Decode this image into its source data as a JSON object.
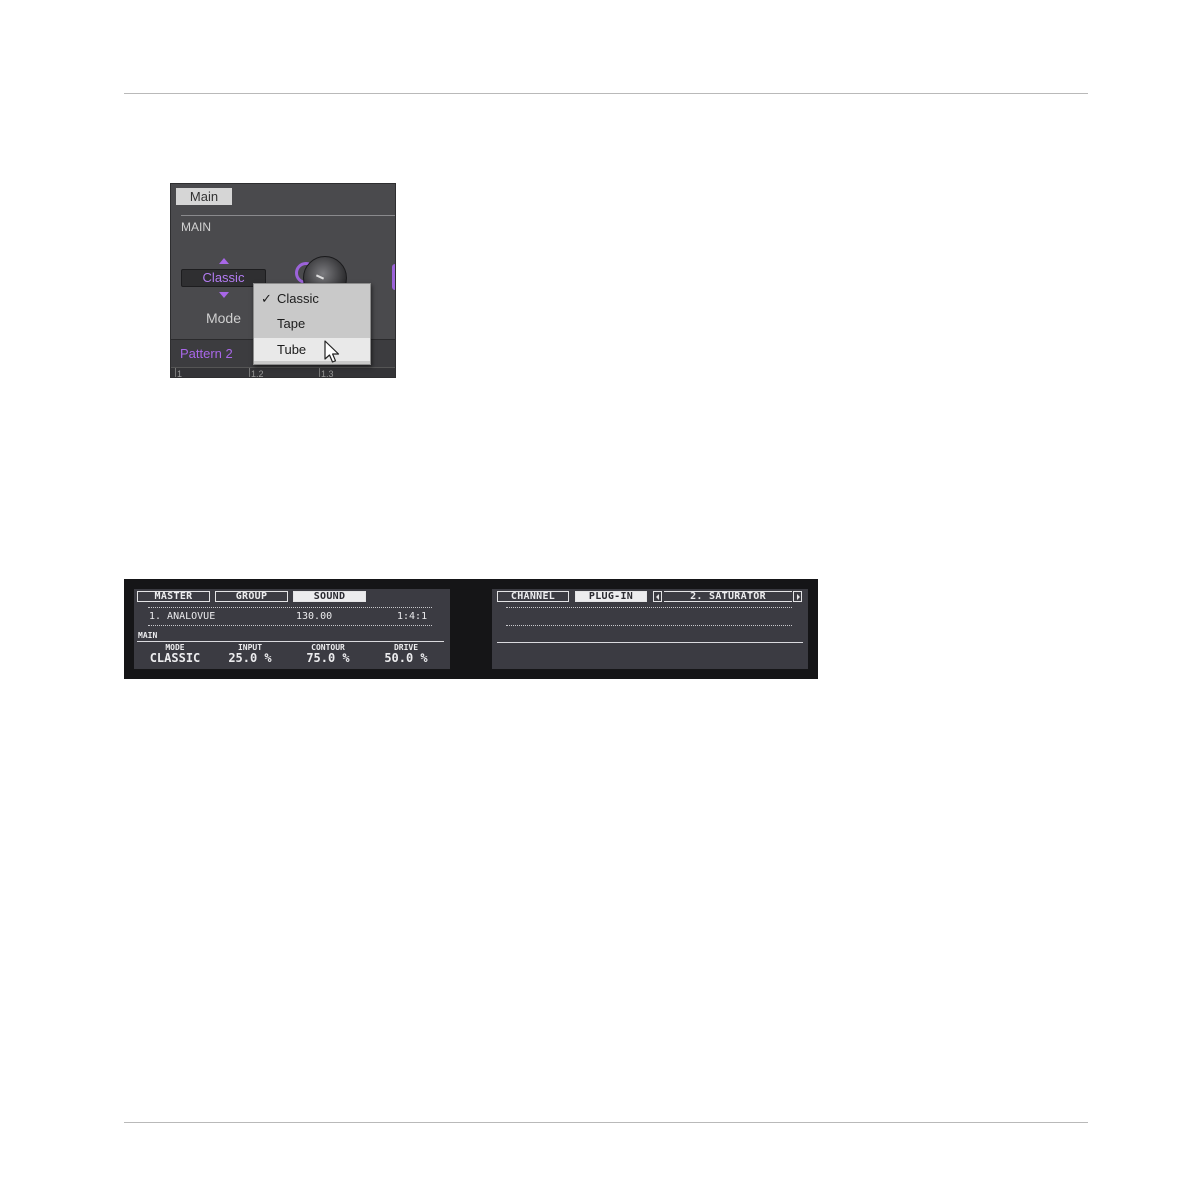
{
  "software": {
    "tab": "Main",
    "section": "MAIN",
    "mode_value": "Classic",
    "mode_label": "Mode",
    "pattern": "Pattern 2",
    "ruler": [
      "1",
      "1.2",
      "1.3"
    ],
    "menu": [
      {
        "label": "Classic",
        "checked": true
      },
      {
        "label": "Tape",
        "checked": false
      },
      {
        "label": "Tube",
        "checked": false,
        "hovered": true
      }
    ],
    "colors": {
      "accent": "#a867e8",
      "panel": "#4a4a4d"
    }
  },
  "hardware": {
    "left": {
      "tabs": [
        "MASTER",
        "GROUP",
        "SOUND"
      ],
      "selected_tab": "SOUND",
      "info": {
        "name": "1. ANALOVUE",
        "tempo": "130.00",
        "position": "1:4:1"
      },
      "section": "MAIN",
      "params": [
        {
          "name": "MODE",
          "value": "CLASSIC"
        },
        {
          "name": "INPUT",
          "value": "25.0 %"
        },
        {
          "name": "CONTOUR",
          "value": "75.0 %"
        },
        {
          "name": "DRIVE",
          "value": "50.0 %"
        }
      ]
    },
    "right": {
      "tabs": [
        "CHANNEL",
        "PLUG-IN"
      ],
      "selected_tab": "PLUG-IN",
      "slot": "2. SATURATOR"
    }
  }
}
